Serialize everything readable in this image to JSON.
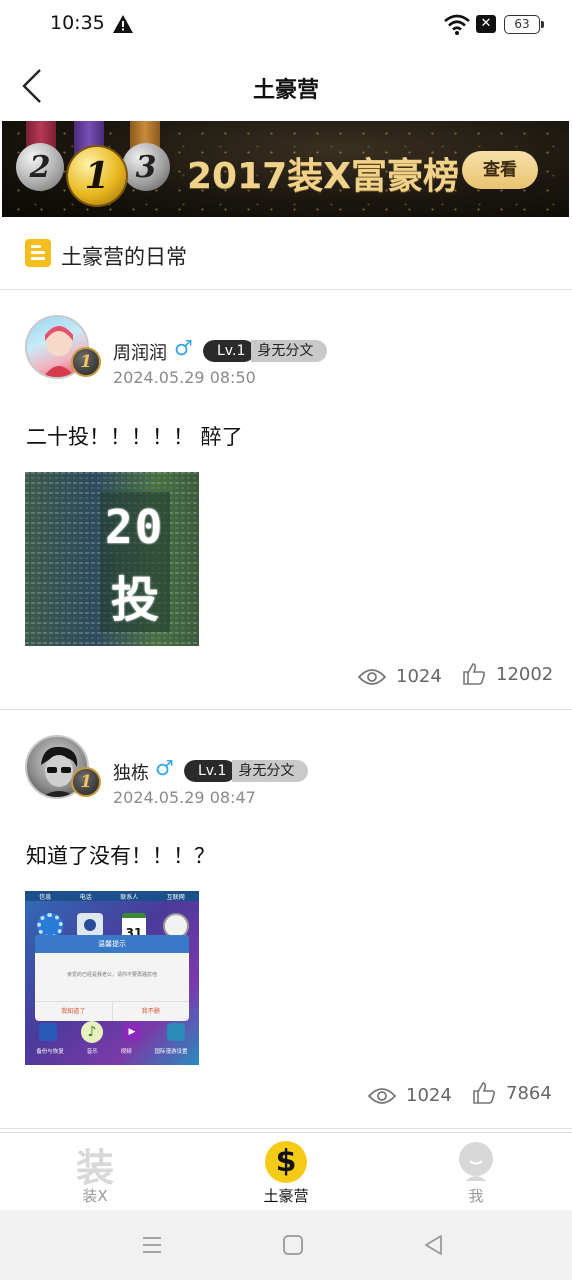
{
  "status_bar": {
    "time": "10:35",
    "battery": "63"
  },
  "header": {
    "title": "土豪营"
  },
  "banner": {
    "medals": [
      "2",
      "1",
      "3"
    ],
    "text": "2017装X富豪榜",
    "button_label": "查看"
  },
  "section": {
    "title": "土豪营的日常"
  },
  "posts": [
    {
      "username": "周润润",
      "gender": "♂",
      "level": "Lv.1",
      "level_title": "身无分文",
      "rank": "1",
      "time": "2024.05.29 08:50",
      "content": "二十投！！！！！ 醉了",
      "image_text": [
        "20",
        "投"
      ],
      "views": "1024",
      "likes": "12002"
    },
    {
      "username": "独栋",
      "gender": "♂",
      "level": "Lv.1",
      "level_title": "身无分文",
      "rank": "1",
      "time": "2024.05.29 08:47",
      "content": "知道了没有！！！？",
      "image": {
        "top_labels": [
          "信息",
          "电话",
          "联系人",
          "互联网"
        ],
        "calendar_day": "31",
        "dialog_title": "温馨提示",
        "dialog_message": "亲爱的已经是我老公，请你不要再骚扰他",
        "dialog_ok": "我知道了",
        "dialog_cancel": "我不删",
        "bottom_labels": [
          "备份与恢复",
          "音乐",
          "视频",
          "国际漫游设置"
        ]
      },
      "views": "1024",
      "likes": "7864"
    }
  ],
  "tabs": [
    {
      "icon_char": "装",
      "label": "装X"
    },
    {
      "icon_char": "$",
      "label": "土豪营"
    },
    {
      "label": "我"
    }
  ],
  "colors": {
    "accent": "#f6be1c",
    "gold_text": "#f1d28a",
    "gender_blue": "#3aa7e6"
  }
}
